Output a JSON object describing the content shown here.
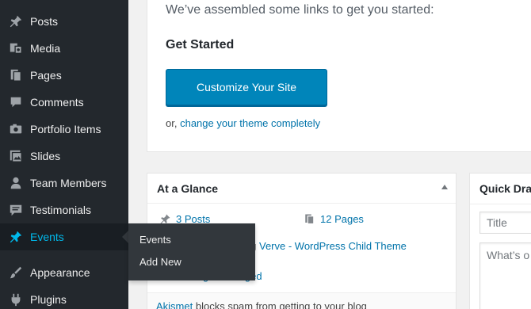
{
  "sidebar": {
    "items": [
      {
        "label": "Posts",
        "icon": "pin-icon"
      },
      {
        "label": "Media",
        "icon": "media-icon"
      },
      {
        "label": "Pages",
        "icon": "pages-icon"
      },
      {
        "label": "Comments",
        "icon": "comment-icon"
      },
      {
        "label": "Portfolio Items",
        "icon": "camera-icon"
      },
      {
        "label": "Slides",
        "icon": "images-icon"
      },
      {
        "label": "Team Members",
        "icon": "user-icon"
      },
      {
        "label": "Testimonials",
        "icon": "testimonial-icon"
      },
      {
        "label": "Events",
        "icon": "pin-icon"
      },
      {
        "label": "Appearance",
        "icon": "brush-icon"
      },
      {
        "label": "Plugins",
        "icon": "plugin-icon"
      }
    ],
    "flyout": [
      "Events",
      "Add New"
    ]
  },
  "welcome": {
    "intro": "We’ve assembled some links to get you started:",
    "heading": "Get Started",
    "button": "Customize Your Site",
    "or_prefix": "or,",
    "or_link": "change your theme completely"
  },
  "glance": {
    "title": "At a Glance",
    "posts": "3 Posts",
    "pages": "12 Pages",
    "theme_prefix": "ing",
    "theme_link": "Verve - WordPress Child Theme",
    "visibility": "ouraged",
    "visibility_prefix": "g",
    "akismet_link": "Akismet",
    "akismet_text": "blocks spam from getting to your blog"
  },
  "quick": {
    "title": "Quick Dra",
    "title_placeholder": "Title",
    "content_placeholder": "What’s o"
  },
  "colors": {
    "sidebar": "#23282d",
    "accent": "#00b9eb",
    "button": "#0085ba",
    "link": "#0073aa"
  }
}
